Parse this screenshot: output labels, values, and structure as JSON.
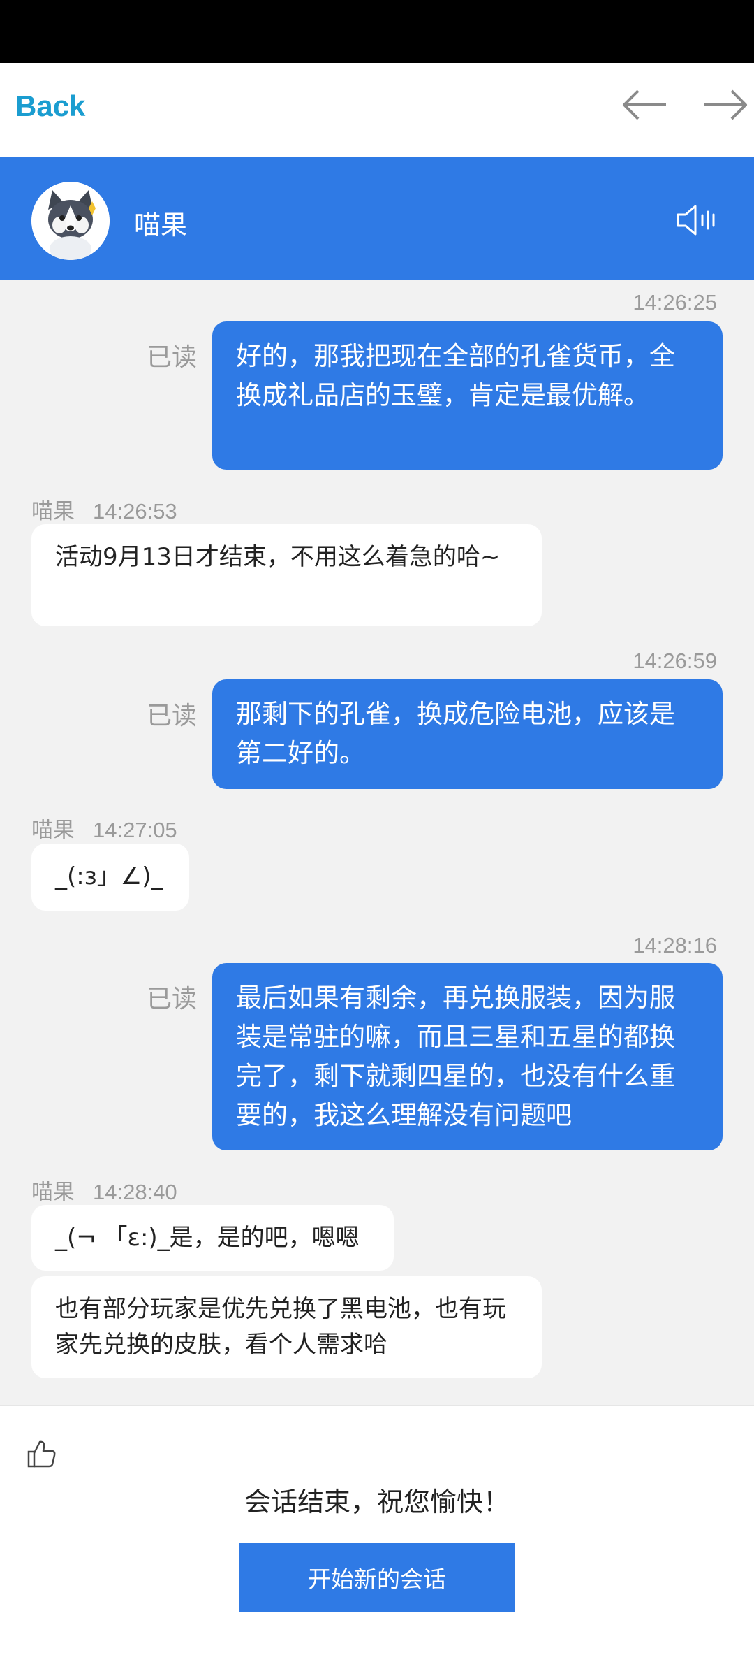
{
  "browser": {
    "back_label": "Back"
  },
  "header": {
    "agent_name": "喵果"
  },
  "messages": [
    {
      "side": "out",
      "time": "14:26:25",
      "read": "已读",
      "text": "好的，那我把现在全部的孔雀货币，全换成礼品店的玉璧，肯定是最优解。"
    },
    {
      "side": "in",
      "sender": "喵果",
      "time": "14:26:53",
      "text": "活动9月13日才结束，不用这么着急的哈~"
    },
    {
      "side": "out",
      "time": "14:26:59",
      "read": "已读",
      "text": "那剩下的孔雀，换成危险电池，应该是第二好的。"
    },
    {
      "side": "in",
      "sender": "喵果",
      "time": "14:27:05",
      "text": "_(:з」∠)_"
    },
    {
      "side": "out",
      "time": "14:28:16",
      "read": "已读",
      "text": "最后如果有剩余，再兑换服装，因为服装是常驻的嘛，而且三星和五星的都换完了，剩下就剩四星的，也没有什么重要的，我这么理解没有问题吧"
    },
    {
      "side": "in",
      "sender": "喵果",
      "time": "14:28:40",
      "text": "_(¬ 「ε:)_是，是的吧，嗯嗯"
    },
    {
      "side": "in",
      "text": "也有部分玩家是优先兑换了黑电池，也有玩家先兑换的皮肤，看个人需求哈"
    }
  ],
  "footer": {
    "end_text": "会话结束，祝您愉快！",
    "new_chat_label": "开始新的会话"
  },
  "colors": {
    "accent": "#2f7ae5",
    "back_link": "#1b9dd0",
    "background": "#f2f2f2"
  },
  "icons": [
    "arrow-left-icon",
    "arrow-right-icon",
    "husky-avatar",
    "speaker-icon",
    "thumbs-up-icon"
  ]
}
